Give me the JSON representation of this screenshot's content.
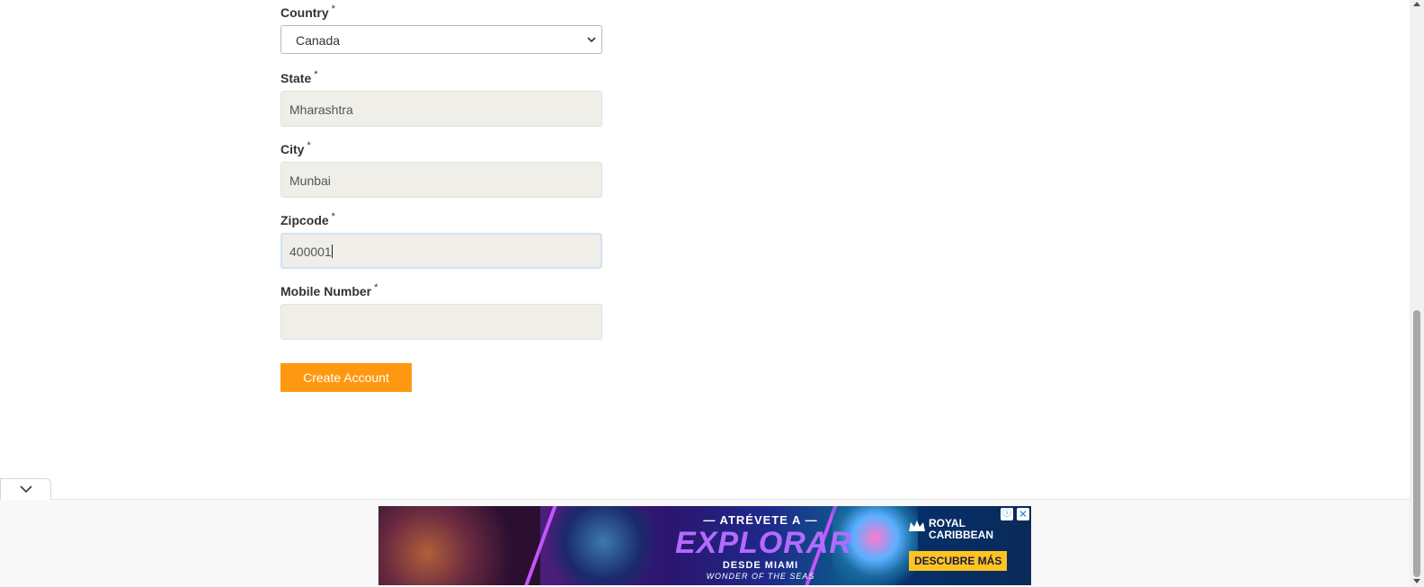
{
  "form": {
    "country": {
      "label": "Country",
      "required_mark": "*",
      "selected": "Canada"
    },
    "state": {
      "label": "State",
      "required_mark": "*",
      "value": "Mharashtra"
    },
    "city": {
      "label": "City",
      "required_mark": "*",
      "value": "Munbai"
    },
    "zipcode": {
      "label": "Zipcode",
      "required_mark": "*",
      "value": "400001"
    },
    "mobile": {
      "label": "Mobile Number",
      "required_mark": "*",
      "value": ""
    },
    "submit_label": "Create Account"
  },
  "ad": {
    "headline_small": "— ATRÉVETE A —",
    "headline_big": "EXPLORAR",
    "sub1": "DESDE MIAMI",
    "sub2": "WONDER OF THE SEAS",
    "brand_line1": "ROYAL",
    "brand_line2": "CARIBBEAN",
    "cta": "DESCUBRE MÁS",
    "choices_glyph": "ⓘ",
    "close_glyph": "✕"
  },
  "colors": {
    "button": "#ff9811",
    "input_bg": "#efeee8",
    "focus_ring": "#cfe2f7",
    "cta": "#ffc322"
  }
}
